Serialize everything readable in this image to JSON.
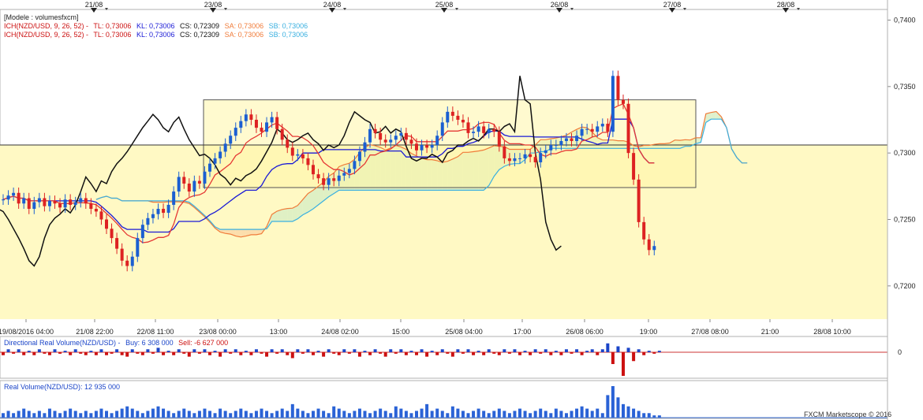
{
  "header": {
    "model_line": "[Modele : volumesfxcm]",
    "ich1": {
      "prefix": "ICH(NZD/USD, 9, 26, 52) -",
      "tl": "TL: 0,73006",
      "kl": "KL: 0,73006",
      "cs": "CS: 0,72309",
      "sa": "SA: 0,73006",
      "sb": "SB: 0,73006"
    },
    "ich2": {
      "prefix": "ICH(NZD/USD, 9, 26, 52) -",
      "tl": "TL: 0,73006",
      "kl": "KL: 0,73006",
      "cs": "CS: 0,72309",
      "sa": "SA: 0,73006",
      "sb": "SB: 0,73006"
    }
  },
  "colors": {
    "tenkan": "#e53935",
    "kijun": "#1a1ad6",
    "chikou": "#111111",
    "span_a": "#f07c3a",
    "span_b": "#3ab0e0",
    "candle_up": "#1b5fd1",
    "candle_down": "#dd2222",
    "cloud_green": "#dff0cf",
    "cloud_orange": "#fde2b6",
    "highlight_fill": "#fff9bf"
  },
  "chart_data": [
    {
      "type": "candlestick",
      "symbol": "NZD/USD",
      "y_ticks": [
        "0,7400",
        "0,7350",
        "0,7300",
        "0,7250",
        "0,7200"
      ],
      "ylim": [
        0.7175,
        0.7408
      ],
      "top_date_labels": [
        "21/08",
        "23/08",
        "24/08",
        "25/08",
        "26/08",
        "27/08",
        "28/08"
      ],
      "x_tick_labels": [
        "19/08/2016 04:00",
        "21/08 22:00",
        "22/08 11:00",
        "23/08 00:00",
        "13:00",
        "24/08 02:00",
        "15:00",
        "25/08 04:00",
        "17:00",
        "26/08 06:00",
        "19:00",
        "27/08 08:00",
        "21:00",
        "28/08 10:00"
      ],
      "horizontal_line": 0.7306,
      "highlight_box": {
        "y_high": 0.734,
        "y_low": 0.7274
      },
      "closes": [
        0.7265,
        0.7268,
        0.727,
        0.7262,
        0.7266,
        0.7258,
        0.7263,
        0.7266,
        0.726,
        0.7264,
        0.7262,
        0.7259,
        0.7265,
        0.7261,
        0.7263,
        0.7266,
        0.7262,
        0.7258,
        0.7256,
        0.725,
        0.7243,
        0.7236,
        0.7228,
        0.7219,
        0.7215,
        0.7222,
        0.7236,
        0.7246,
        0.7251,
        0.7254,
        0.7258,
        0.7255,
        0.7261,
        0.7271,
        0.7282,
        0.7277,
        0.7271,
        0.7279,
        0.7277,
        0.7286,
        0.7292,
        0.7296,
        0.7301,
        0.7307,
        0.7313,
        0.7319,
        0.7324,
        0.7329,
        0.7325,
        0.7319,
        0.7316,
        0.7323,
        0.7327,
        0.7318,
        0.731,
        0.7304,
        0.7298,
        0.7299,
        0.7296,
        0.7291,
        0.7284,
        0.7281,
        0.7276,
        0.7281,
        0.7279,
        0.7283,
        0.7285,
        0.7288,
        0.7294,
        0.7301,
        0.7308,
        0.7318,
        0.7315,
        0.731,
        0.7308,
        0.731,
        0.7313,
        0.7315,
        0.731,
        0.7307,
        0.7302,
        0.7306,
        0.7304,
        0.7306,
        0.7313,
        0.7323,
        0.7331,
        0.7328,
        0.7325,
        0.7323,
        0.7315,
        0.7316,
        0.732,
        0.7315,
        0.7318,
        0.7316,
        0.7305,
        0.7296,
        0.7294,
        0.7296,
        0.7296,
        0.7299,
        0.7297,
        0.7293,
        0.73,
        0.7302,
        0.7306,
        0.7306,
        0.7309,
        0.7311,
        0.7309,
        0.7313,
        0.7318,
        0.7318,
        0.7316,
        0.732,
        0.7322,
        0.7316,
        0.7358,
        0.734,
        0.7337,
        0.73,
        0.728,
        0.7248,
        0.7235,
        0.7227,
        0.723
      ],
      "volume_profile": {
        "label": "Real Volume(NZD/USD): 12 935 000",
        "values": [
          2,
          3,
          2,
          3,
          4,
          3,
          2,
          3,
          2,
          4,
          3,
          2,
          3,
          4,
          3,
          2,
          3,
          2,
          3,
          4,
          3,
          2,
          3,
          4,
          5,
          4,
          3,
          2,
          3,
          4,
          5,
          4,
          3,
          2,
          3,
          4,
          3,
          2,
          3,
          4,
          3,
          2,
          4,
          3,
          2,
          3,
          4,
          3,
          2,
          3,
          4,
          3,
          2,
          3,
          4,
          3,
          6,
          4,
          3,
          2,
          3,
          4,
          3,
          2,
          5,
          4,
          3,
          2,
          3,
          4,
          3,
          2,
          3,
          4,
          3,
          2,
          5,
          4,
          3,
          2,
          3,
          4,
          6,
          3,
          4,
          3,
          2,
          5,
          4,
          3,
          2,
          3,
          4,
          3,
          2,
          3,
          4,
          3,
          2,
          3,
          4,
          3,
          2,
          3,
          4,
          3,
          2,
          4,
          3,
          2,
          3,
          4,
          5,
          4,
          3,
          4,
          2,
          10,
          14,
          9,
          6,
          5,
          4,
          3,
          2,
          2,
          1,
          1
        ]
      }
    },
    {
      "type": "bar",
      "name": "Directional Real Volume(NZD/USD)",
      "label_prefix": "Directional Real Volume(NZD/USD) -",
      "buy_label": "Buy: 6 308 000",
      "sell_label": "Sell: -6 627 000",
      "y_ticks": [
        "0"
      ],
      "values": [
        -2,
        2,
        -1,
        2,
        -2,
        1,
        -2,
        2,
        -1,
        -2,
        2,
        -1,
        1,
        -2,
        2,
        -1,
        -2,
        1,
        -2,
        2,
        -2,
        -1,
        2,
        -2,
        -3,
        2,
        -1,
        -2,
        2,
        -1,
        3,
        -2,
        1,
        -2,
        2,
        -1,
        -3,
        2,
        -1,
        2,
        -2,
        1,
        -3,
        2,
        -1,
        2,
        -2,
        1,
        -2,
        2,
        -1,
        -3,
        2,
        -1,
        2,
        -2,
        -4,
        2,
        -1,
        2,
        -2,
        1,
        -3,
        2,
        -1,
        -2,
        2,
        -1,
        2,
        -3,
        1,
        -2,
        2,
        -1,
        -3,
        2,
        -1,
        2,
        -2,
        1,
        -2,
        2,
        -3,
        1,
        -2,
        2,
        -1,
        -3,
        2,
        -1,
        2,
        -2,
        1,
        -2,
        2,
        -1,
        -2,
        2,
        -1,
        2,
        -2,
        1,
        -2,
        2,
        -1,
        2,
        -2,
        1,
        -2,
        2,
        -1,
        2,
        -2,
        1,
        2,
        -2,
        2,
        6,
        -8,
        4,
        -16,
        3,
        -6,
        2,
        -2,
        1,
        -1,
        1
      ]
    }
  ],
  "footer": {
    "copyright": "FXCM Marketscope © 2016"
  }
}
